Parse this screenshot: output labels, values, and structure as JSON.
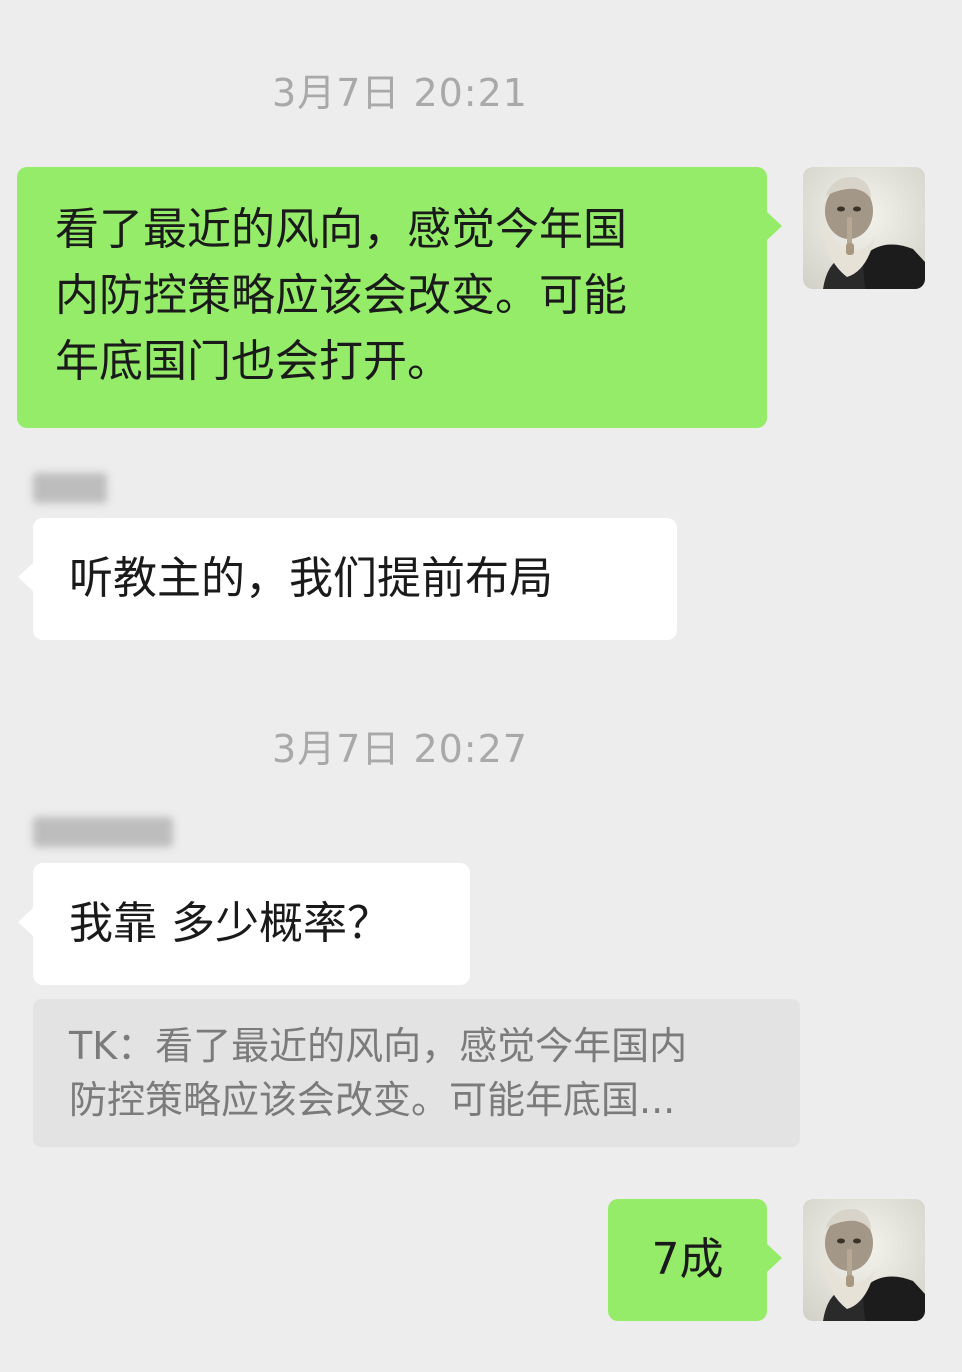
{
  "chat": {
    "timestamp_1": "3月7日 20:21",
    "timestamp_2": "3月7日 20:27",
    "msg1": {
      "line1": "看了最近的风向，感觉今年国",
      "line2": "内防控策略应该会改变。可能",
      "line3": "年底国门也会打开。"
    },
    "msg2": {
      "text": "听教主的，我们提前布局"
    },
    "msg3": {
      "text": "我靠 多少概率？"
    },
    "quote": {
      "line1": "TK：看了最近的风向，感觉今年国内",
      "line2": "防控策略应该会改变。可能年底国..."
    },
    "msg4": {
      "text": "7成"
    },
    "avatar_icon": "bearded-old-man-portrait",
    "colors": {
      "background": "#ededed",
      "outgoing_bubble": "#95ec69",
      "incoming_bubble": "#ffffff",
      "quote_block": "#e3e3e3",
      "timestamp_text": "#a9a9a9"
    }
  }
}
